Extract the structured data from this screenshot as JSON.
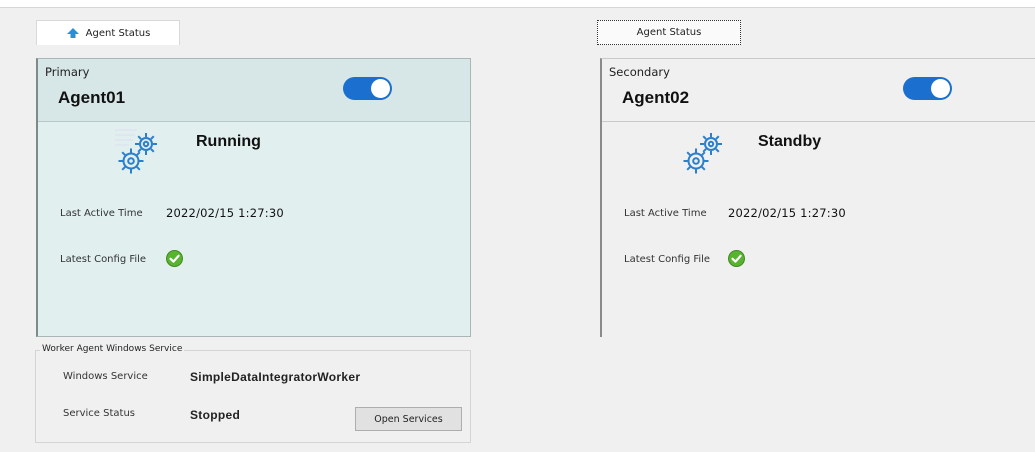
{
  "tabs": {
    "left_label": "Agent Status",
    "right_label": "Agent Status",
    "left_icon": "upload-arrow-icon"
  },
  "primary": {
    "role": "Primary",
    "name": "Agent01",
    "enabled": true,
    "status": "Running",
    "last_active_label": "Last Active Time",
    "last_active_value": "2022/02/15 1:27:30",
    "config_label": "Latest Config File",
    "config_ok": true
  },
  "secondary": {
    "role": "Secondary",
    "name": "Agent02",
    "enabled": true,
    "status": "Standby",
    "last_active_label": "Last Active Time",
    "last_active_value": "2022/02/15 1:27:30",
    "config_label": "Latest Config File",
    "config_ok": true
  },
  "service": {
    "group_title": "Worker Agent Windows Service",
    "windows_service_label": "Windows Service",
    "windows_service_value": "SimpleDataIntegratorWorker",
    "service_status_label": "Service Status",
    "service_status_value": "Stopped",
    "open_button_label": "Open Services"
  },
  "colors": {
    "toggle_on": "#1b6fcf",
    "active_panel_bg": "#e2efef",
    "check_green": "#58b430"
  },
  "icons": [
    "gears-icon",
    "check-circle-icon",
    "upload-arrow-icon"
  ]
}
